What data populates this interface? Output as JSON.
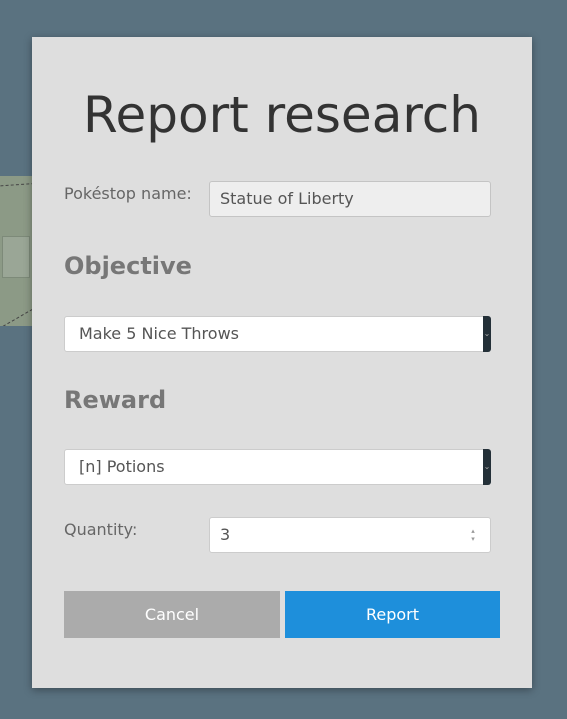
{
  "dialog": {
    "title": "Report research",
    "pokestop_label": "Pokéstop name:",
    "pokestop_value": "Statue of Liberty",
    "objective_heading": "Objective",
    "objective_selected": "Make 5 Nice Throws",
    "reward_heading": "Reward",
    "reward_selected": "[n] Potions",
    "quantity_label": "Quantity:",
    "quantity_value": "3",
    "cancel_label": "Cancel",
    "report_label": "Report"
  },
  "colors": {
    "backdrop": "#5a7280",
    "dialog_bg": "#dedede",
    "report_button": "#1e8fdb",
    "cancel_button": "#ababab"
  },
  "icons": {
    "select_handle": "chevron-down-icon",
    "quantity_spinner": "spinner-arrows-icon"
  }
}
